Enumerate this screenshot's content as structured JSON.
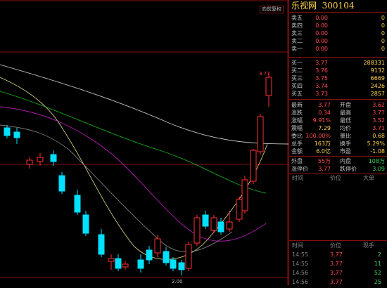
{
  "toolbar": {
    "button_label": "向前复权"
  },
  "chart": {
    "high_label": "3.77",
    "low_label": "2.00",
    "up_color": "#ff3030",
    "down_color": "#00e0ff",
    "ma_colors": [
      "#e0e0e0",
      "#f0e68c",
      "#d020d0",
      "#20c020",
      "#909090"
    ]
  },
  "stock": {
    "name": "乐视网",
    "code": "300104"
  },
  "asks": [
    {
      "label": "卖五",
      "price": "0.00",
      "vol": "0"
    },
    {
      "label": "卖四",
      "price": "0.00",
      "vol": "0"
    },
    {
      "label": "卖三",
      "price": "0.00",
      "vol": "0"
    },
    {
      "label": "卖二",
      "price": "0.00",
      "vol": "0"
    },
    {
      "label": "卖一",
      "price": "0.00",
      "vol": "0"
    }
  ],
  "bids": [
    {
      "label": "买一",
      "price": "3.77",
      "vol": "288331"
    },
    {
      "label": "买二",
      "price": "3.76",
      "vol": "9132"
    },
    {
      "label": "买三",
      "price": "3.75",
      "vol": "6669"
    },
    {
      "label": "买四",
      "price": "3.74",
      "vol": "2426"
    },
    {
      "label": "买五",
      "price": "3.73",
      "vol": "2857"
    }
  ],
  "stats": [
    {
      "l1": "最新",
      "v1": "3.77",
      "c1": "red",
      "l2": "开盘",
      "v2": "3.62",
      "c2": "red"
    },
    {
      "l1": "涨跌",
      "v1": "0.34",
      "c1": "red",
      "l2": "最高",
      "v2": "3.77",
      "c2": "red"
    },
    {
      "l1": "涨幅",
      "v1": "9.91%",
      "c1": "red",
      "l2": "最低",
      "v2": "3.52",
      "c2": "red"
    },
    {
      "l1": "震幅",
      "v1": "7.29",
      "c1": "yel",
      "l2": "均价",
      "v2": "3.71",
      "c2": "red"
    },
    {
      "l1": "委比",
      "v1": "100.00%",
      "c1": "red",
      "l2": "量比",
      "v2": "0.68",
      "c2": "yel"
    },
    {
      "l1": "总手",
      "v1": "163万",
      "c1": "yel",
      "l2": "换手",
      "v2": "5.29%",
      "c2": "yel"
    },
    {
      "l1": "金额",
      "v1": "6.0亿",
      "c1": "yel",
      "l2": "市盈",
      "v2": "-1.08",
      "c2": "yel"
    }
  ],
  "outer": {
    "l1": "外盘",
    "v1": "55万",
    "l2": "内盘",
    "v2": "108万"
  },
  "limits": {
    "l1": "涨停价",
    "v1": "3.77",
    "l2": "跌停价",
    "v2": "3.09"
  },
  "ticks_header_top": {
    "c1": "时间",
    "c2": "价位",
    "c3": "大单"
  },
  "ticks_header": {
    "c1": "时间",
    "c2": "价位",
    "c3": "现手"
  },
  "ticks": [
    {
      "time": "14:55",
      "price": "3.77",
      "vol": "2"
    },
    {
      "time": "14:55",
      "price": "3.77",
      "vol": "11"
    },
    {
      "time": "14:56",
      "price": "3.77",
      "vol": "52"
    },
    {
      "time": "14:56",
      "price": "3.77",
      "vol": "25"
    }
  ]
}
